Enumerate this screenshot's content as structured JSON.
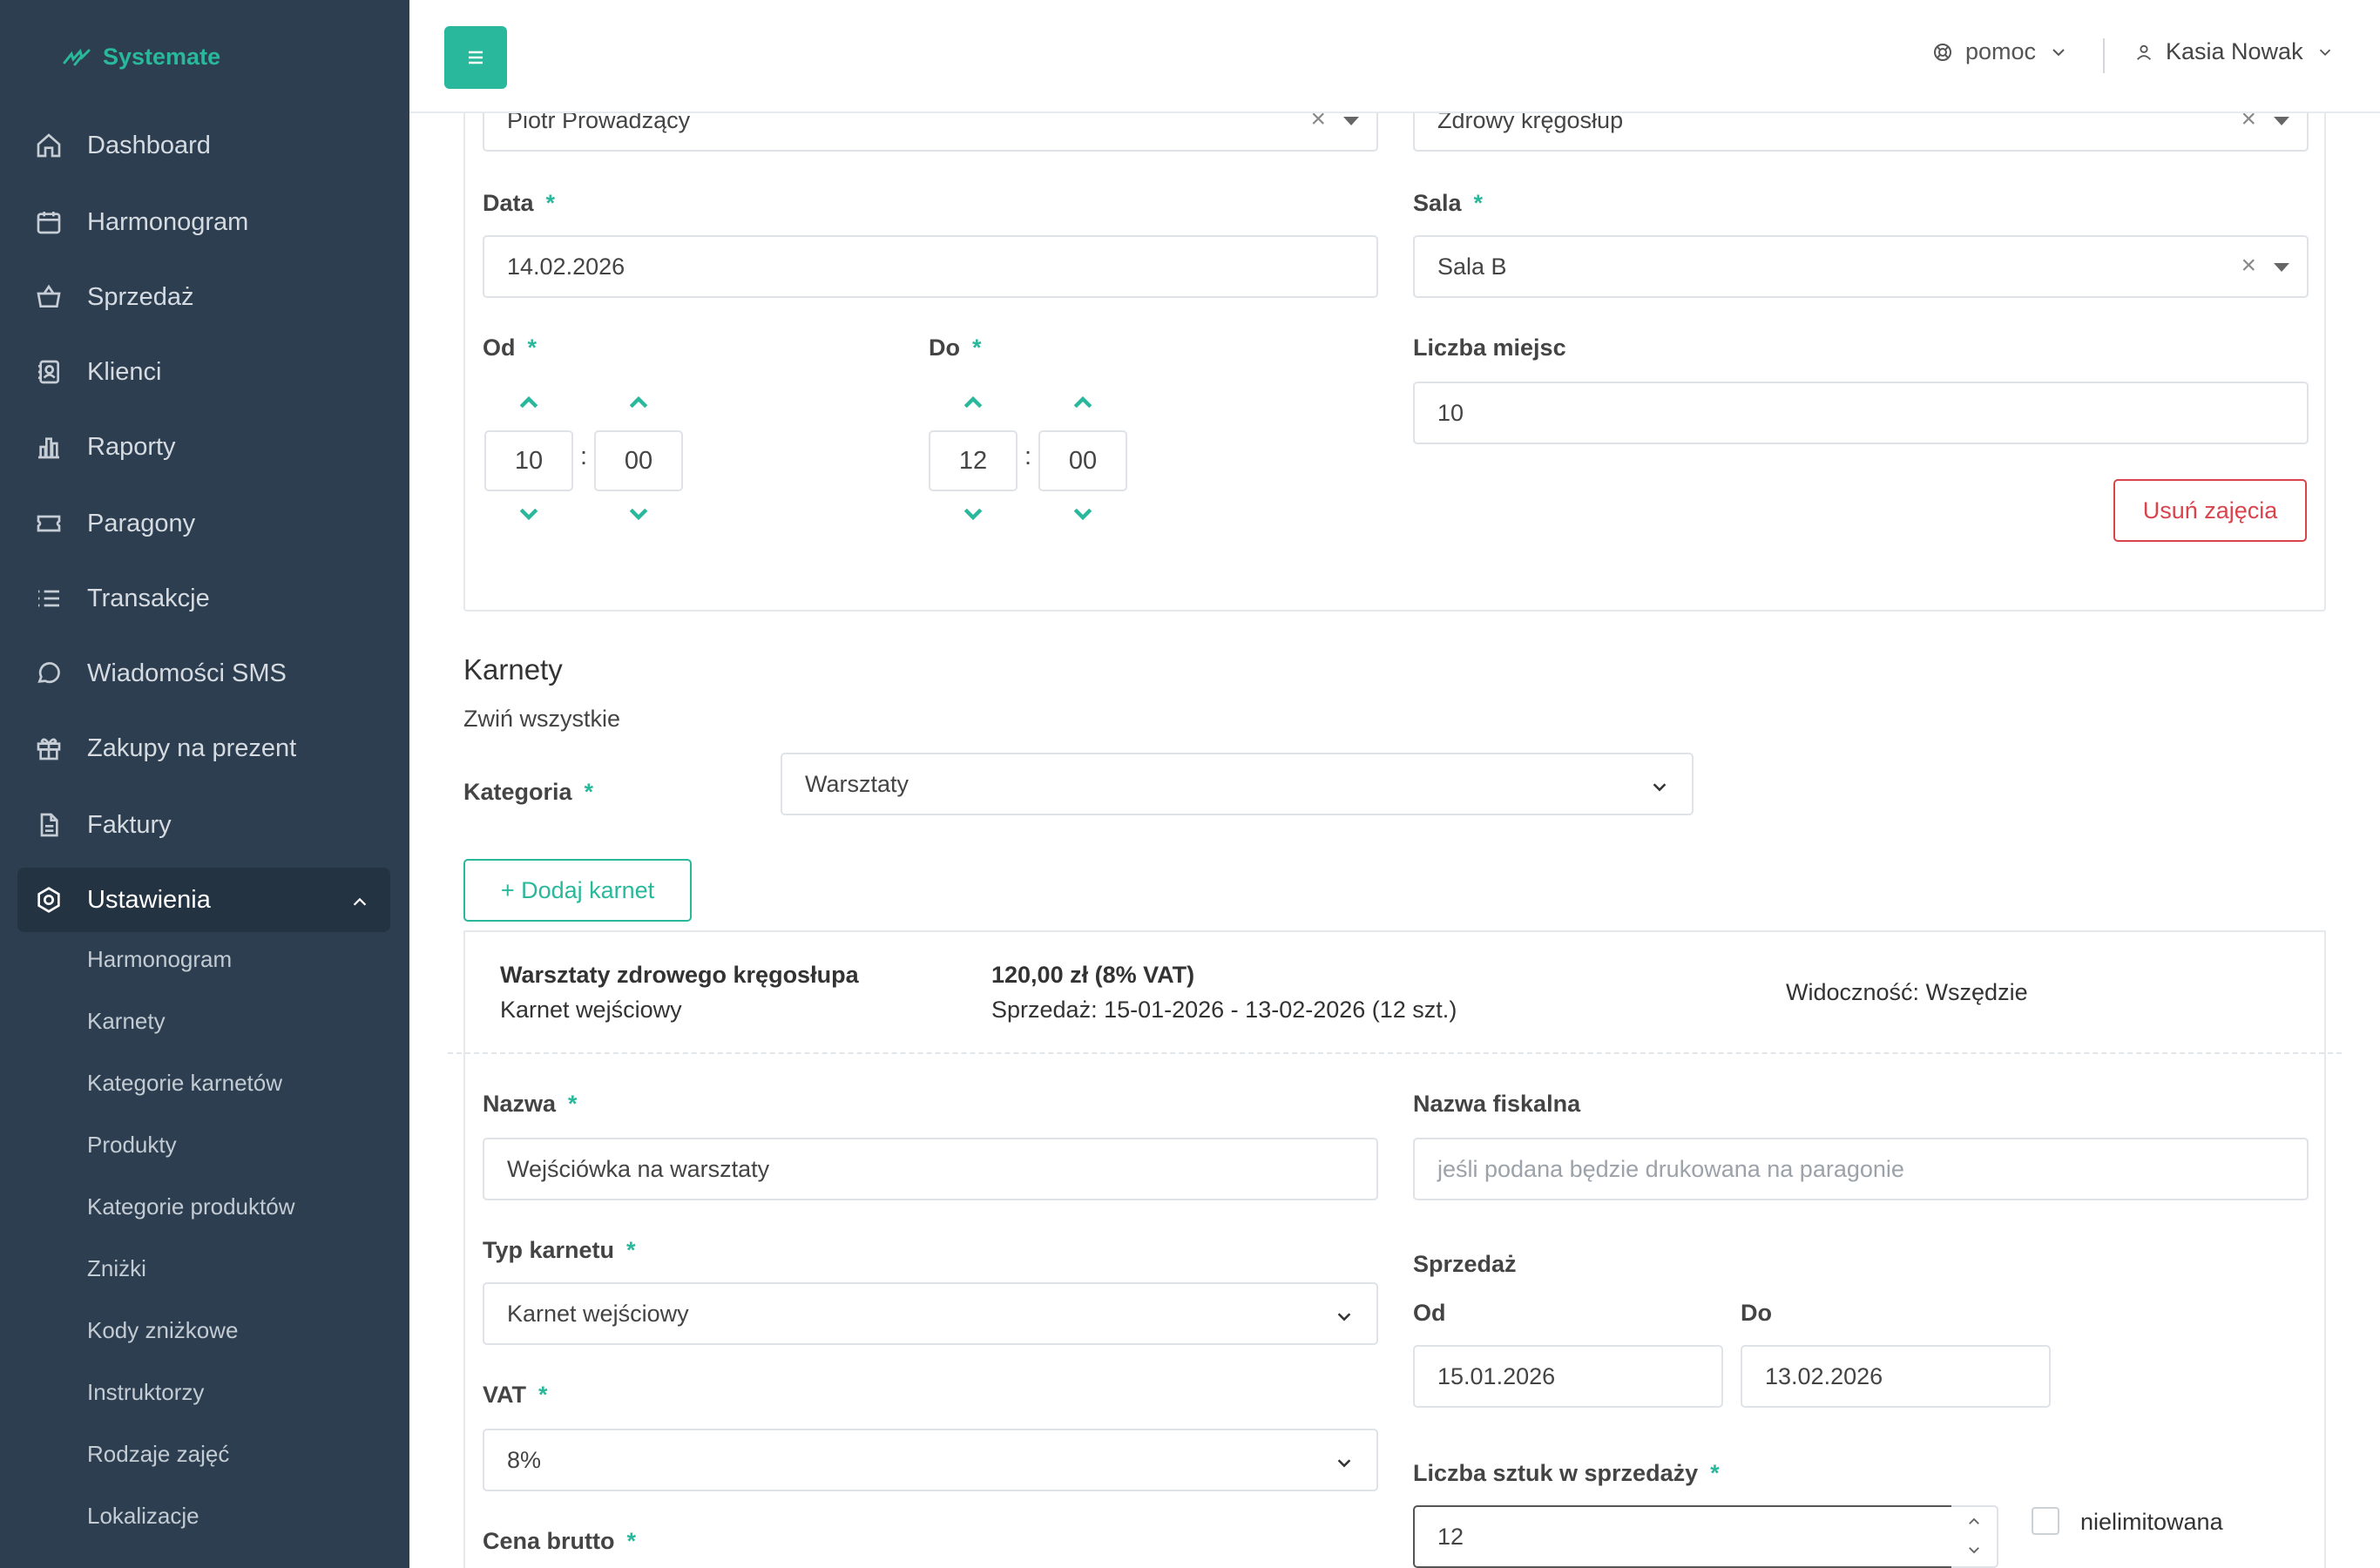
{
  "app": {
    "logo_text": "Systemate"
  },
  "sidebar": {
    "items": [
      {
        "label": "Dashboard",
        "icon": "home-icon"
      },
      {
        "label": "Harmonogram",
        "icon": "calendar-icon"
      },
      {
        "label": "Sprzedaż",
        "icon": "basket-icon"
      },
      {
        "label": "Klienci",
        "icon": "address-book-icon"
      },
      {
        "label": "Raporty",
        "icon": "bar-chart-icon"
      },
      {
        "label": "Paragony",
        "icon": "ticket-icon"
      },
      {
        "label": "Transakcje",
        "icon": "list-icon"
      },
      {
        "label": "Wiadomości SMS",
        "icon": "chat-icon"
      },
      {
        "label": "Zakupy na prezent",
        "icon": "gift-icon"
      },
      {
        "label": "Faktury",
        "icon": "document-icon"
      },
      {
        "label": "Ustawienia",
        "icon": "settings-icon"
      }
    ],
    "subitems": [
      "Harmonogram",
      "Karnety",
      "Kategorie karnetów",
      "Produkty",
      "Kategorie produktów",
      "Zniżki",
      "Kody zniżkowe",
      "Instruktorzy",
      "Rodzaje zajęć",
      "Lokalizacje"
    ]
  },
  "header": {
    "help_label": "pomoc",
    "user_name": "Kasia Nowak"
  },
  "class_form": {
    "instructor_value": "Piotr Prowadzący",
    "class_type_value": "Zdrowy kręgosłup",
    "date_label": "Data",
    "date_value": "14.02.2026",
    "room_label": "Sala",
    "room_value": "Sala B",
    "from_label": "Od",
    "to_label": "Do",
    "from_hour": "10",
    "from_min": "00",
    "to_hour": "12",
    "to_min": "00",
    "seats_label": "Liczba miejsc",
    "seats_value": "10",
    "delete_button": "Usuń zajęcia",
    "required_mark": "*",
    "colon": ":"
  },
  "passes": {
    "title": "Karnety",
    "collapse_all": "Zwiń wszystkie",
    "category_label": "Kategoria",
    "category_value": "Warsztaty",
    "add_button": "+ Dodaj karnet",
    "summary": {
      "name": "Warsztaty zdrowego kręgosłupa",
      "type": "Karnet wejściowy",
      "price": "120,00 zł (8% VAT)",
      "sale": "Sprzedaż: 15-01-2026 - 13-02-2026 (12 szt.)",
      "visibility": "Widoczność: Wszędzie"
    },
    "form": {
      "name_label": "Nazwa",
      "name_value": "Wejściówka na warsztaty",
      "fiscal_label": "Nazwa fiskalna",
      "fiscal_placeholder": "jeśli podana będzie drukowana na paragonie",
      "type_label": "Typ karnetu",
      "type_value": "Karnet wejściowy",
      "sale_label": "Sprzedaż",
      "sale_from_label": "Od",
      "sale_to_label": "Do",
      "sale_from_value": "15.01.2026",
      "sale_to_value": "13.02.2026",
      "vat_label": "VAT",
      "vat_value": "8%",
      "qty_label": "Liczba sztuk w sprzedaży",
      "qty_value": "12",
      "unlimited_label": "nielimitowana",
      "price_label": "Cena brutto"
    }
  },
  "colors": {
    "accent": "#29b89b",
    "sidebar_bg": "#2d3e50",
    "danger": "#d9434c"
  }
}
